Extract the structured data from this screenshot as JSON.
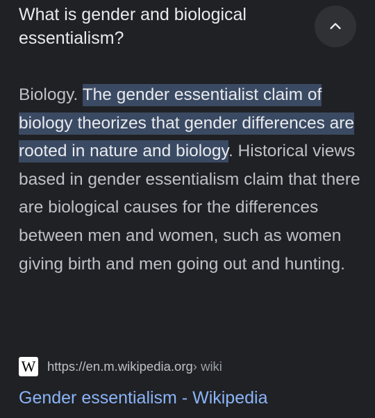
{
  "question": {
    "text": "What is gender and biological essentialism?"
  },
  "collapse_button": {
    "icon": "chevron-up-icon"
  },
  "answer": {
    "lead": "Biology.",
    "highlighted": "The gender essentialist claim of biology theorizes that gender differences are rooted in nature and biology",
    "rest": ". Historical views based in gender essentialism claim that there are biological causes for the differences between men and women, such as women giving birth and men going out and hunting."
  },
  "source": {
    "logo_letter": "W",
    "url": "https://en.m.wikipedia.org",
    "path": " › wiki",
    "title": "Gender essentialism - Wikipedia"
  },
  "colors": {
    "background": "#202124",
    "highlight": "#3b4a63",
    "link": "#8ab4f8"
  }
}
